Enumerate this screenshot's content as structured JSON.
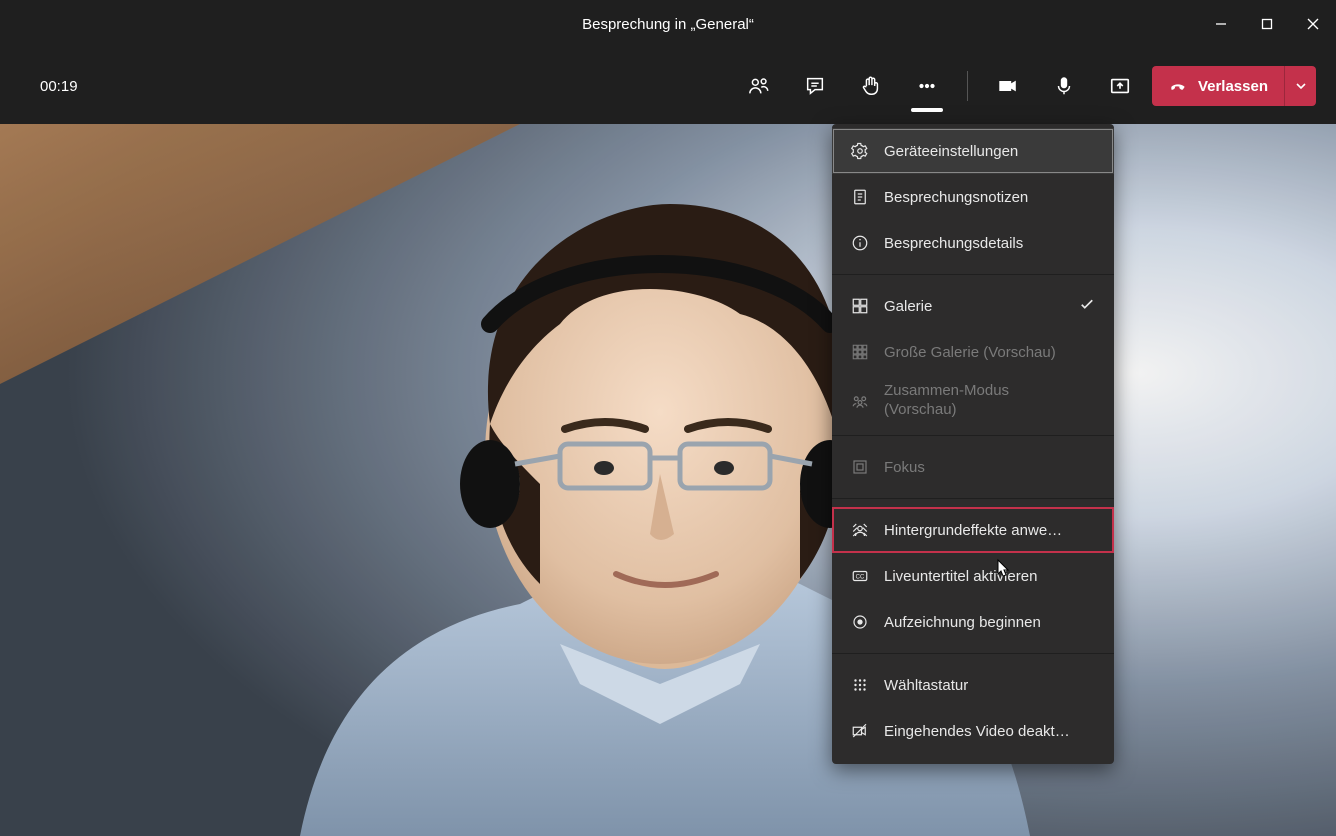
{
  "window": {
    "title": "Besprechung in „General“"
  },
  "call": {
    "timer": "00:19",
    "leave_label": "Verlassen"
  },
  "menu": {
    "device_settings": "Geräteeinstellungen",
    "meeting_notes": "Besprechungsnotizen",
    "meeting_details": "Besprechungsdetails",
    "gallery": "Galerie",
    "large_gallery": "Große Galerie (Vorschau)",
    "together_line1": "Zusammen-Modus",
    "together_line2": "(Vorschau)",
    "focus": "Fokus",
    "background_effects": "Hintergrundeffekte anwe…",
    "live_captions": "Liveuntertitel aktivieren",
    "start_recording": "Aufzeichnung beginnen",
    "dialpad": "Wähltastatur",
    "disable_incoming_video": "Eingehendes Video deakt…"
  }
}
